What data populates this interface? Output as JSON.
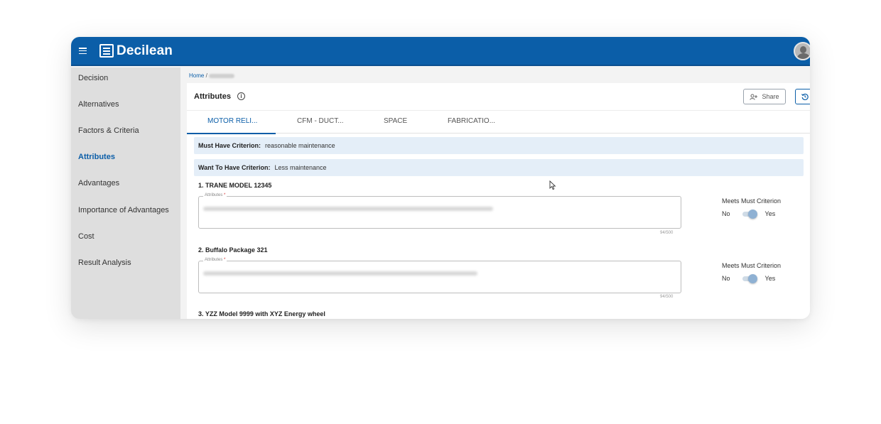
{
  "app": {
    "name": "Decilean"
  },
  "sidebar": {
    "items": [
      {
        "label": "Decision",
        "active": false
      },
      {
        "label": "Alternatives",
        "active": false
      },
      {
        "label": "Factors & Criteria",
        "active": false
      },
      {
        "label": "Attributes",
        "active": true
      },
      {
        "label": "Advantages",
        "active": false
      },
      {
        "label": "Importance of Advantages",
        "active": false
      },
      {
        "label": "Cost",
        "active": false
      },
      {
        "label": "Result Analysis",
        "active": false
      }
    ]
  },
  "breadcrumb": {
    "home": "Home",
    "separator": "/"
  },
  "header": {
    "title": "Attributes",
    "share_label": "Share"
  },
  "tabs": [
    {
      "label": "MOTOR RELI...",
      "active": true
    },
    {
      "label": "CFM - DUCT...",
      "active": false
    },
    {
      "label": "SPACE",
      "active": false
    },
    {
      "label": "FABRICATIO...",
      "active": false
    }
  ],
  "criteria": {
    "must": {
      "label": "Must Have Criterion:",
      "value": "reasonable maintenance"
    },
    "want": {
      "label": "Want To Have Criterion:",
      "value": "Less maintenance"
    }
  },
  "alternatives": [
    {
      "title": "1. TRANE MODEL 12345",
      "field_label": "Attributes",
      "required_mark": "*",
      "counter": "94/500",
      "meets_label": "Meets Must Criterion",
      "no_label": "No",
      "yes_label": "Yes",
      "meets": true
    },
    {
      "title": "2. Buffalo Package 321",
      "field_label": "Attributes",
      "required_mark": "*",
      "counter": "94/500",
      "meets_label": "Meets Must Criterion",
      "no_label": "No",
      "yes_label": "Yes",
      "meets": true
    },
    {
      "title": "3. YZZ Model 9999 with XYZ Energy wheel"
    }
  ],
  "colors": {
    "brand": "#0b5ea8",
    "criterion_bg": "#e4eef8",
    "sidebar_bg": "#dedede"
  },
  "icons": {
    "menu": "hamburger-icon",
    "logo": "decilean-logo-icon",
    "info": "info-icon",
    "share": "share-icon",
    "history": "history-icon",
    "avatar": "user-avatar-icon"
  }
}
